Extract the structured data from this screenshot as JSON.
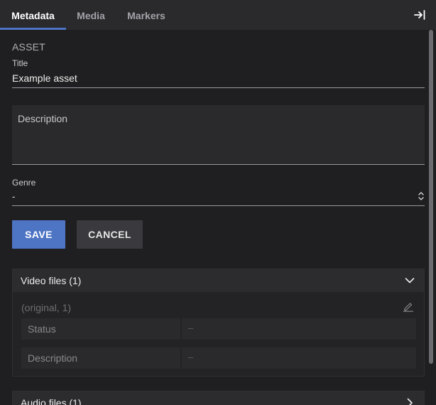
{
  "tabs": [
    {
      "label": "Metadata",
      "active": true
    },
    {
      "label": "Media",
      "active": false
    },
    {
      "label": "Markers",
      "active": false
    }
  ],
  "collapse_icon": "collapse-right-icon",
  "form": {
    "section_title": "ASSET",
    "title": {
      "label": "Title",
      "value": "Example asset"
    },
    "description": {
      "placeholder": "Description",
      "value": ""
    },
    "genre": {
      "label": "Genre",
      "value": "-"
    }
  },
  "buttons": {
    "save": "SAVE",
    "cancel": "CANCEL"
  },
  "video_files": {
    "title": "Video files (1)",
    "expanded": true,
    "file": {
      "name": "(original, 1)",
      "properties": [
        {
          "key": "Status",
          "value": "–"
        },
        {
          "key": "Description",
          "value": "–"
        }
      ]
    }
  },
  "audio_files": {
    "title": "Audio files (1)",
    "expanded": false
  },
  "colors": {
    "accent": "#4e74c4",
    "background": "#1f1f21",
    "tab_bar": "#2a2a2d"
  }
}
